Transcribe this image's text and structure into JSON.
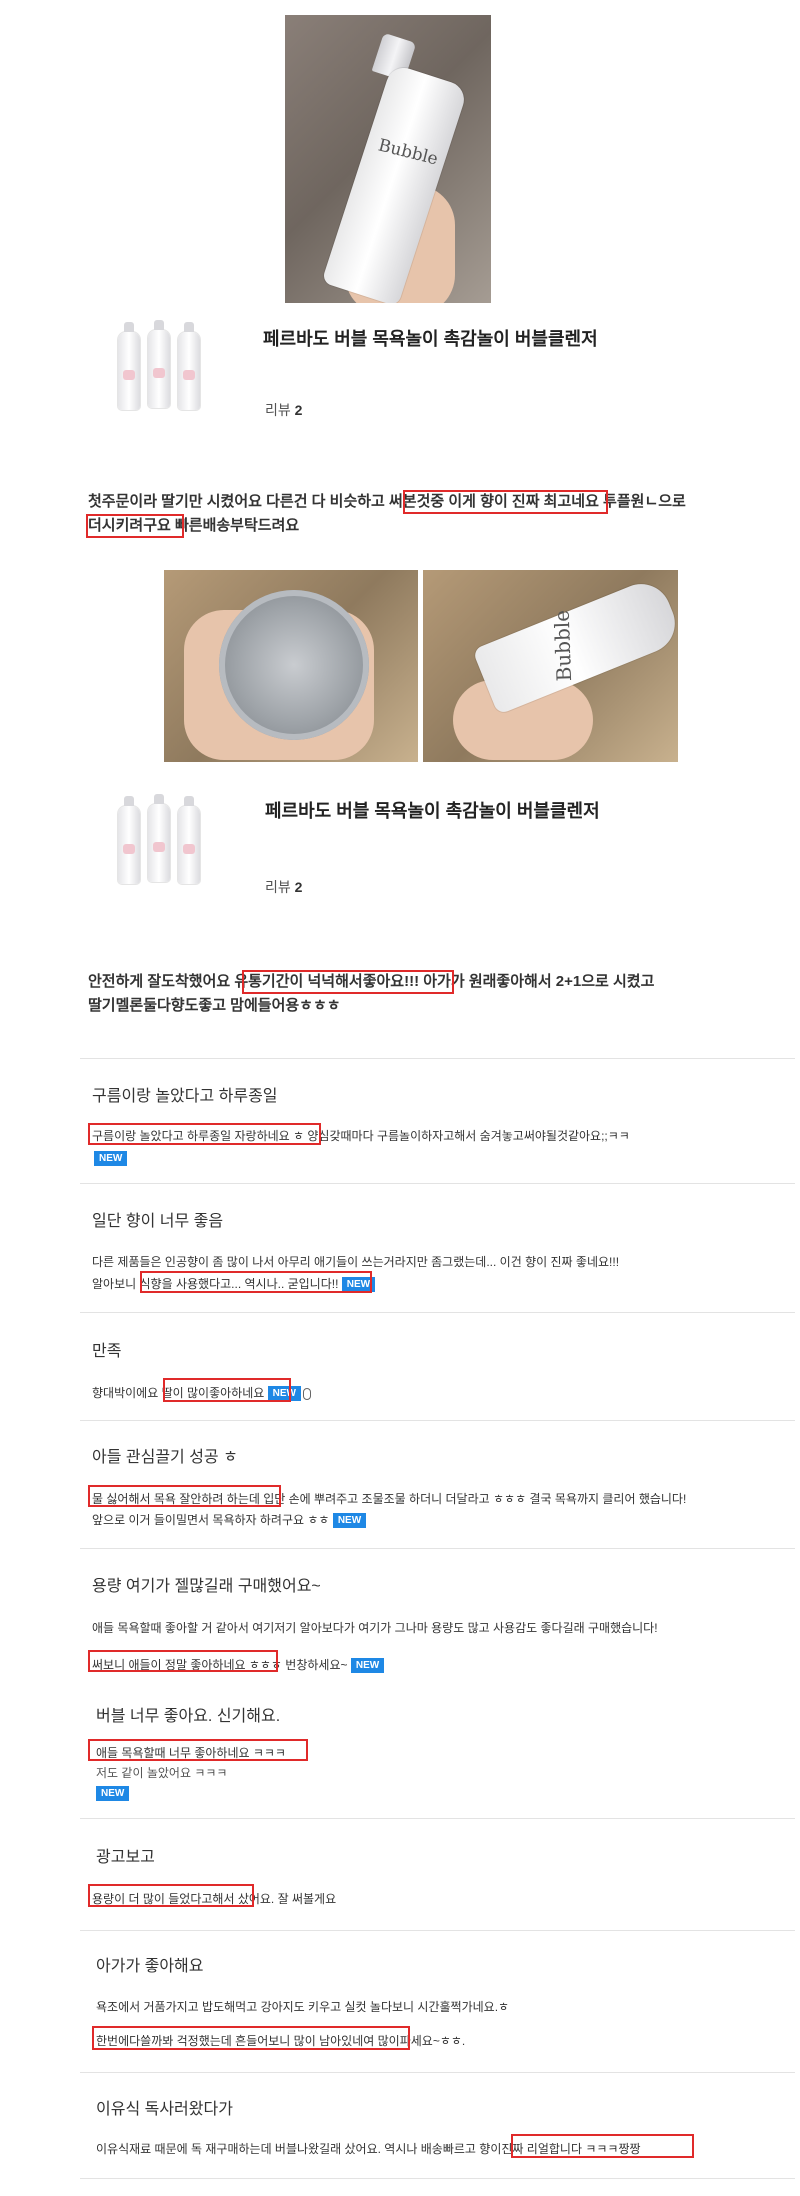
{
  "products": [
    {
      "title": "페르바도 버블 목욕놀이 촉감놀이 버블클렌저",
      "review_label": "리뷰",
      "review_count": "2"
    },
    {
      "title": "페르바도 버블 목욕놀이 촉감놀이 버블클렌저",
      "review_label": "리뷰",
      "review_count": "2"
    }
  ],
  "bottle_brand": "Bubble",
  "review1": {
    "line1": "첫주문이라 딸기만 시켰어요 다른건 다 비슷하고 써본것중 이게 향이 진짜 최고네요 투플원ㄴ으로",
    "line2": "더시키려구요 빠른배송부탁드려요"
  },
  "review2": {
    "line1": "안전하게 잘도착했어요 유통기간이 넉넉해서좋아요!!! 아가가 원래좋아해서 2+1으로 시켰고",
    "line2": "딸기멜론둘다향도좋고 맘에들어용ㅎㅎㅎ"
  },
  "new_badge": "NEW",
  "reviews": [
    {
      "title": "구름이랑 놀았다고 하루종일",
      "lines": [
        "구름이랑 놀았다고 하루종일 자랑하네요 ㅎ 양심갖때마다 구름놀이하자고해서 숨겨놓고써야될것같아요;;ㅋㅋ"
      ]
    },
    {
      "title": "일단 향이 너무 좋음",
      "lines": [
        "다른 제품들은 인공향이 좀 많이 나서 아무리 애기들이 쓰는거라지만 좀그랬는데... 이건 향이 진짜 좋네요!!!",
        "알아보니 식향을 사용했다고... 역시나.. 굳입니다!!"
      ]
    },
    {
      "title": "만족",
      "lines": [
        "향대박이에요 딸이 많이좋아하네요"
      ]
    },
    {
      "title": "아들 관심끌기 성공 ㅎ",
      "lines": [
        "물 싫어해서 목욕 잘안하려 하는데 입단 손에 뿌려주고 조물조물 하더니 더달라고 ㅎㅎㅎ 결국 목욕까지 클리어 했습니다!",
        "앞으로 이거 들이밀면서 목욕하자 하려구요 ㅎㅎ"
      ]
    },
    {
      "title": "용량 여기가 젤많길래 구매했어요~",
      "lines": [
        "애들 목욕할때 좋아할 거 같아서 여기저기 알아보다가 여기가 그나마 용량도 많고 사용감도 좋다길래 구매했습니다!",
        "써보니 애들이 정말 좋아하네요 ㅎㅎㅎ 번창하세요~"
      ]
    },
    {
      "title": "버블 너무 좋아요. 신기해요.",
      "lines": [
        "애들 목욕할때 너무 좋아하네요 ㅋㅋㅋ",
        "저도 같이 놀았어요 ㅋㅋㅋ"
      ]
    },
    {
      "title": "광고보고",
      "lines": [
        "용량이 더 많이 들었다고해서 샀어요. 잘 써볼게요"
      ]
    },
    {
      "title": "아가가 좋아해요",
      "lines": [
        "욕조에서 거품가지고 밥도해먹고 강아지도 키우고 실컷 놀다보니 시간훌쩍가네요.ㅎ",
        "한번에다쓸까봐 걱정했는데 흔들어보니 많이 남아있네여 많이파세요~ㅎㅎ."
      ]
    },
    {
      "title": "이유식 독사러왔다가",
      "lines": [
        "이유식재료 때문에 독 재구매하는데 버블나왔길래 샀어요. 역시나 배송빠르고 향이진짜 리얼합니다 ㅋㅋㅋ짱짱"
      ]
    }
  ]
}
